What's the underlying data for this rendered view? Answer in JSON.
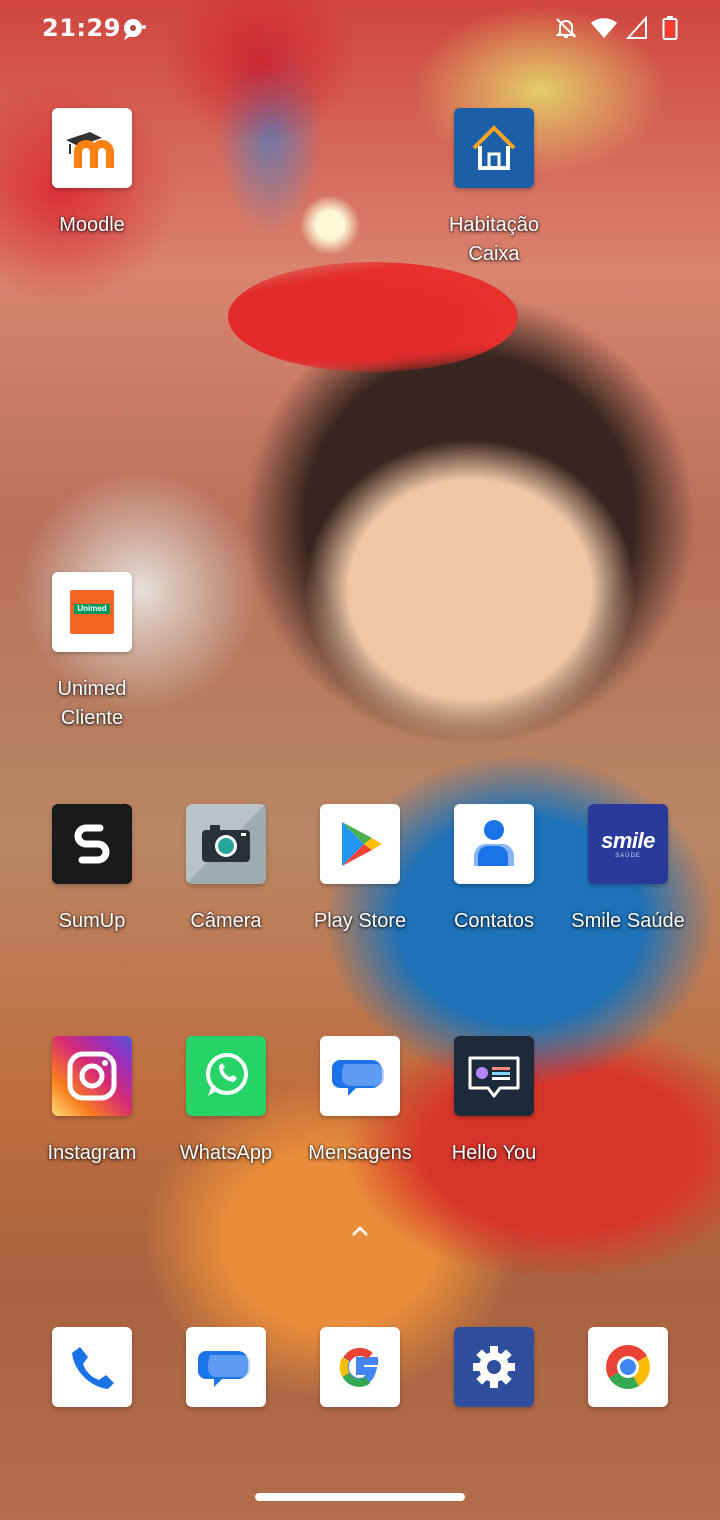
{
  "status_bar": {
    "time": "21:29",
    "icons": [
      "chat-bubble-icon",
      "mute-bell-icon",
      "wifi-icon",
      "cell-signal-icon",
      "battery-low-icon"
    ]
  },
  "home_grid": [
    {
      "label": "Moodle",
      "icon": "moodle-icon"
    },
    {
      "label": "Habitação\nCaixa",
      "icon": "house-icon"
    },
    {
      "label": "Unimed\nCliente",
      "icon": "unimed-icon",
      "badge_text": "Unimed"
    },
    {
      "label": "SumUp",
      "icon": "sumup-icon"
    },
    {
      "label": "Câmera",
      "icon": "camera-icon"
    },
    {
      "label": "Play Store",
      "icon": "play-store-icon"
    },
    {
      "label": "Contatos",
      "icon": "contacts-icon"
    },
    {
      "label": "Smile Saúde",
      "icon": "smile-icon",
      "logo_text": "smile",
      "logo_sub": "SAÚDE"
    },
    {
      "label": "Instagram",
      "icon": "instagram-icon"
    },
    {
      "label": "WhatsApp",
      "icon": "whatsapp-icon"
    },
    {
      "label": "Mensagens",
      "icon": "messages-icon"
    },
    {
      "label": "Hello You",
      "icon": "hello-you-icon"
    }
  ],
  "dock": [
    {
      "name": "Phone",
      "icon": "phone-icon"
    },
    {
      "name": "Messages",
      "icon": "messages-icon"
    },
    {
      "name": "Google",
      "icon": "google-icon"
    },
    {
      "name": "Settings",
      "icon": "settings-icon"
    },
    {
      "name": "Chrome",
      "icon": "chrome-icon"
    }
  ],
  "colors": {
    "moodle_orange": "#f98012",
    "caixa_blue": "#1c5fa8",
    "unimed_orange": "#f26522",
    "unimed_green": "#00995d",
    "sumup_black": "#1a1a1a",
    "smile_blue": "#2a3a9a",
    "whatsapp_green": "#25d366",
    "hello_you_navy": "#1e2a3a",
    "settings_blue": "#2f4f9e"
  }
}
